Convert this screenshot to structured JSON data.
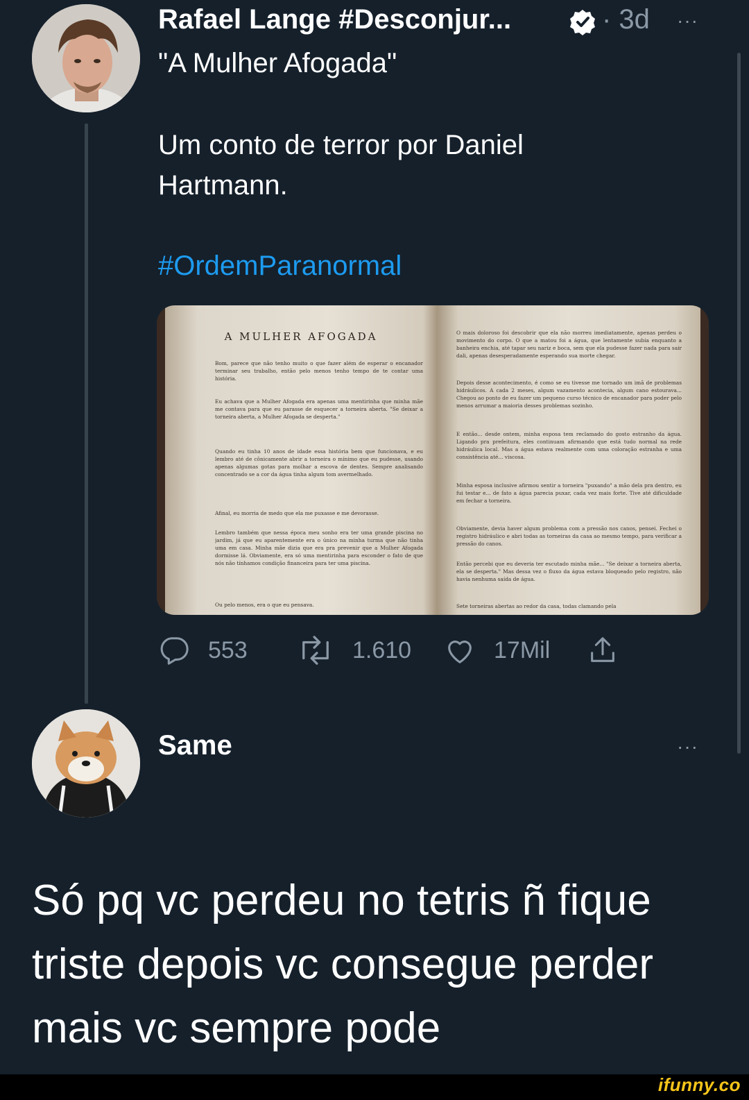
{
  "tweet": {
    "author": "Rafael Lange #Desconjur...",
    "time": "· 3d",
    "title_line": "\"A Mulher Afogada\"",
    "body_line1": "Um conto de terror por Daniel",
    "body_line2": "Hartmann.",
    "hashtag": "#OrdemParanormal",
    "more": "···"
  },
  "book": {
    "title": "A MULHER AFOGADA",
    "left_paragraphs": [
      "Bom, parece que não tenho muito o que fazer além de esperar o encanador terminar seu trabalho, então pelo menos tenho tempo de te contar uma história.",
      "Eu achava que a Mulher Afogada era apenas uma mentirinha que minha mãe me contava para que eu parasse de esquecer a torneira aberta. \"Se deixar a torneira aberta, a Mulher Afogada se desperta.\"",
      "Quando eu tinha 10 anos de idade essa história bem que funcionava, e eu lembro até de cônicamente abrir a torneira o mínimo que eu pudesse, usando apenas algumas gotas para molhar a escova de dentes. Sempre analisando concentrado se a cor da água tinha algum tom avermelhado.",
      "Afinal, eu morria de medo que ela me puxasse e me devorasse.",
      "Lembro também que nessa época meu sonho era ter uma grande piscina no jardim, já que eu aparentemente era o único na minha turma que não tinha uma em casa. Minha mãe dizia que era pra prevenir que a Mulher Afogada dormisse lá. Obviamente, era só uma mentirinha para esconder o fato de que nós não tínhamos condição financeira para ter uma piscina.",
      "Ou pelo menos, era o que eu pensava."
    ],
    "right_paragraphs": [
      "O mais doloroso foi descobrir que ela não morreu imediatamente, apenas perdeu o movimento do corpo. O que a matou foi a água, que lentamente subia enquanto a banheira enchia, até tapar seu nariz e boca, sem que ela pudesse fazer nada para sair dali, apenas desesperadamente esperando sua morte chegar.",
      "Depois desse acontecimento, é como se eu tivesse me tornado um imã de problemas hidráulicos. A cada 2 meses, algum vazamento acontecia, algum cano estourava... Chegou ao ponto de eu fazer um pequeno curso técnico de encanador para poder pelo menos arrumar a maioria desses problemas sozinho.",
      "E então... desde ontem, minha esposa tem reclamado do gosto estranho da água. Ligando pra prefeitura, eles continuam afirmando que está tudo normal na rede hidráulica local. Mas a água estava realmente com uma coloração estranha e uma consistência até... viscosa.",
      "Minha esposa inclusive afirmou sentir a torneira \"puxando\" a mão dela pra dentro, eu fui testar e... de fato a água parecia puxar, cada vez mais forte. Tive até dificuldade em fechar a torneira.",
      "Obviamente, devia haver algum problema com a pressão nos canos, pensei. Fechei o registro hidráulico e abri todas as torneiras da casa ao mesmo tempo, para verificar a pressão do canos.",
      "Então percebi que eu deveria ter escutado minha mãe... \"Se deixar a torneira aberta, ela se desperta.\" Mas dessa vez o fluxo da água estava bloqueado pelo registro, não havia nenhuma saída de água.",
      "Sete torneiras abertas ao redor da casa, todas clamando pela"
    ]
  },
  "actions": {
    "replies": "553",
    "retweets": "1.610",
    "likes": "17Mil"
  },
  "reply": {
    "author": "Same",
    "more": "···",
    "text": "Só pq vc perdeu no tetris ñ fique triste depois vc consegue perder mais vc sempre pode"
  },
  "watermark": "ifunny.co",
  "colors": {
    "background": "#15202b",
    "accent": "#1d9bf0",
    "muted": "#8b98a5",
    "watermark": "#f7c51a"
  }
}
